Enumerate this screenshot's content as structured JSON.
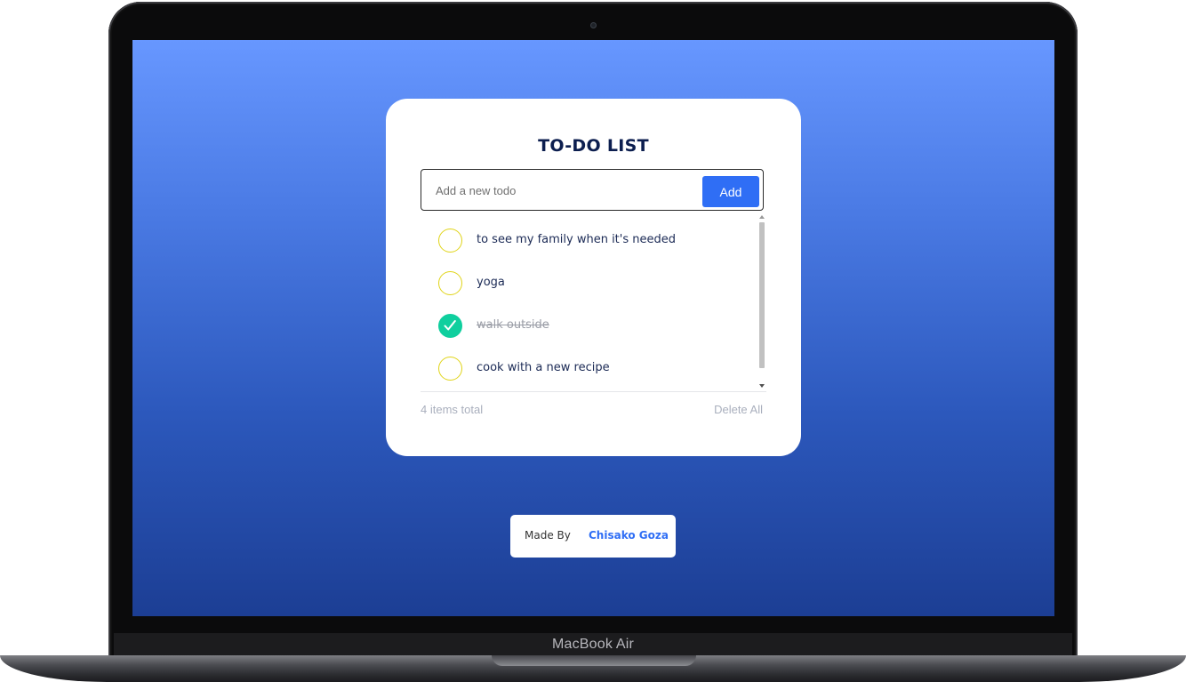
{
  "device": {
    "model_name": "MacBook Air"
  },
  "app": {
    "title": "TO-DO LIST",
    "input": {
      "placeholder": "Add a new todo",
      "value": ""
    },
    "add_button_label": "Add",
    "todos": [
      {
        "text": "to see my family when it's needed",
        "completed": false
      },
      {
        "text": "yoga",
        "completed": false
      },
      {
        "text": "walk outside",
        "completed": true
      },
      {
        "text": "cook with a new recipe",
        "completed": false
      }
    ],
    "footer": {
      "count_text": "4 items total",
      "delete_all_label": "Delete All"
    }
  },
  "credit": {
    "label": "Made By",
    "author": "Chisako Goza"
  },
  "colors": {
    "accent": "#2f6ef5",
    "check_done": "#0fcf9e",
    "check_open_border": "#e0d418",
    "title": "#0c1e4f"
  }
}
